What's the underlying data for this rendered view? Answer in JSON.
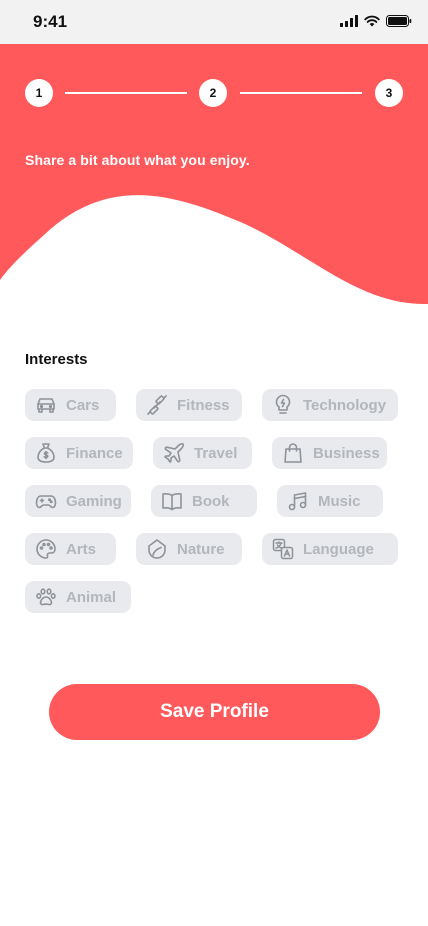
{
  "status_bar": {
    "time": "9:41"
  },
  "stepper": {
    "steps": [
      "1",
      "2",
      "3"
    ]
  },
  "hero": {
    "subtitle": "Share a bit about what you enjoy."
  },
  "interests": {
    "title": "Interests",
    "items": [
      {
        "label": "Cars",
        "icon": "car-icon"
      },
      {
        "label": "Fitness",
        "icon": "dumbbell-icon"
      },
      {
        "label": "Technology",
        "icon": "lightbulb-icon"
      },
      {
        "label": "Finance",
        "icon": "money-bag-icon"
      },
      {
        "label": "Travel",
        "icon": "airplane-icon"
      },
      {
        "label": "Business",
        "icon": "shopping-bag-icon"
      },
      {
        "label": "Gaming",
        "icon": "gamepad-icon"
      },
      {
        "label": "Book",
        "icon": "book-icon"
      },
      {
        "label": "Music",
        "icon": "music-note-icon"
      },
      {
        "label": "Arts",
        "icon": "palette-icon"
      },
      {
        "label": "Nature",
        "icon": "leaf-icon"
      },
      {
        "label": "Language",
        "icon": "translate-icon"
      },
      {
        "label": "Animal",
        "icon": "paw-icon"
      }
    ]
  },
  "actions": {
    "save_label": "Save Profile"
  },
  "colors": {
    "accent": "#ff595c",
    "chip_bg": "#e9eaed",
    "chip_text": "#b2b6bd"
  }
}
